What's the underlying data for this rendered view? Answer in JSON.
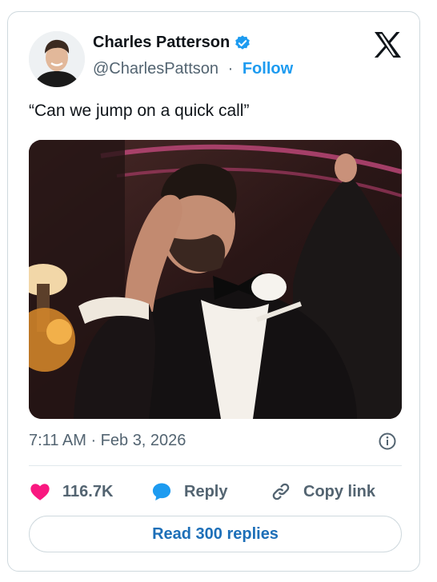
{
  "author": {
    "name": "Charles Patterson",
    "handle": "@CharlesPattson",
    "separator": "·",
    "follow_label": "Follow",
    "verified_icon": "verified-badge-icon"
  },
  "tweet": {
    "text": "“Can we jump on a quick call”",
    "timestamp": "7:11 AM · Feb 3, 2026"
  },
  "actions": {
    "like_count": "116.7K",
    "reply_label": "Reply",
    "copy_link_label": "Copy link"
  },
  "footer": {
    "read_replies_label": "Read 300 replies"
  },
  "colors": {
    "accent": "#1d9bf0",
    "like": "#f91880",
    "text_secondary": "#536471",
    "border": "#cfd9de"
  }
}
